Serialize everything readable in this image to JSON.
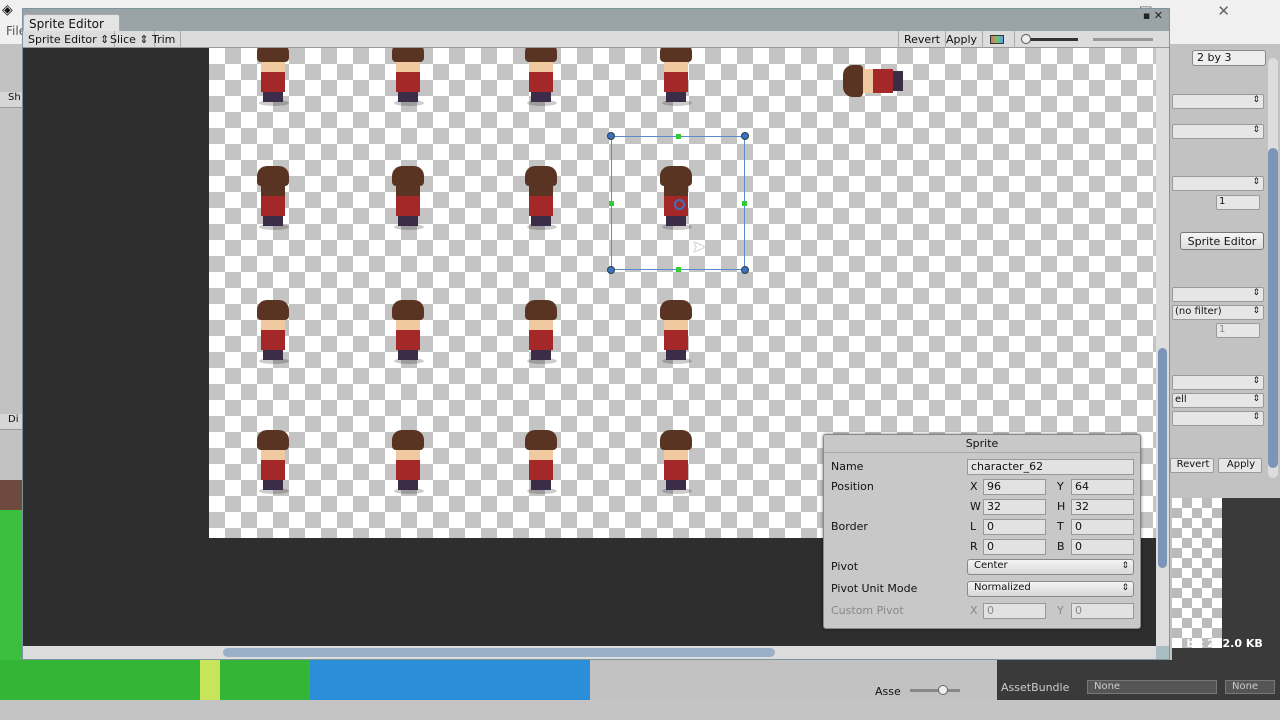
{
  "app": {
    "menu_file": "File",
    "window_controls": "□ ✕"
  },
  "window": {
    "tab_title": "Sprite Editor",
    "buttons": "▪ ✕"
  },
  "toolbar": {
    "mode": "Sprite Editor",
    "slice": "Slice",
    "trim": "Trim",
    "revert": "Revert",
    "apply": "Apply"
  },
  "left_panel": {
    "tab1": "Sh",
    "tab2": "Di"
  },
  "inspector": {
    "grid_dropdown": "2 by 3",
    "value1": "1",
    "sprite_editor_button": "Sprite Editor",
    "filter": "(no filter)",
    "value2": "1",
    "dropdown_partial": "ell",
    "revert": "Revert",
    "apply": "Apply",
    "size_info": "2 bit  272.0 KB"
  },
  "sprite_panel": {
    "title": "Sprite",
    "name_label": "Name",
    "name_value": "character_62",
    "position_label": "Position",
    "x": "96",
    "y": "64",
    "w": "32",
    "h": "32",
    "border_label": "Border",
    "l": "0",
    "t": "0",
    "r": "0",
    "b": "0",
    "pivot_label": "Pivot",
    "pivot_value": "Center",
    "pivot_unit_label": "Pivot Unit Mode",
    "pivot_unit_value": "Normalized",
    "custom_pivot_label": "Custom Pivot",
    "custom_x": "0",
    "custom_y": "0"
  },
  "bottom": {
    "asset_label": "Asse",
    "assetbundle_label": "AssetBundle",
    "bundle_value": "None",
    "variant_value": "None"
  },
  "colors": {
    "accent": "#3f6fc0",
    "canvas_bg": "#2e2e2e"
  }
}
